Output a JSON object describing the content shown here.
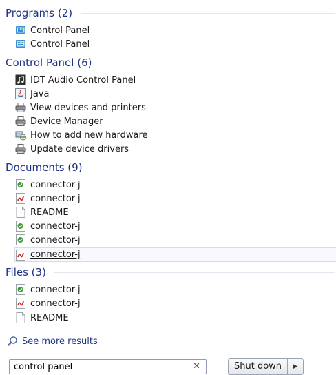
{
  "groups": {
    "programs": {
      "title": "Programs (2)",
      "items": [
        {
          "label": "Control Panel",
          "icon": "control-panel-icon"
        },
        {
          "label": "Control Panel",
          "icon": "control-panel-icon"
        }
      ]
    },
    "control_panel": {
      "title": "Control Panel (6)",
      "items": [
        {
          "label": "IDT Audio Control Panel",
          "icon": "audio-note-icon"
        },
        {
          "label": "Java",
          "icon": "java-icon"
        },
        {
          "label": "View devices and printers",
          "icon": "printer-icon"
        },
        {
          "label": "Device Manager",
          "icon": "printer-icon"
        },
        {
          "label": "How to add new hardware",
          "icon": "hardware-icon"
        },
        {
          "label": "Update device drivers",
          "icon": "printer-icon"
        }
      ]
    },
    "documents": {
      "title": "Documents (9)",
      "items": [
        {
          "label": "connector-j",
          "icon": "green-doc-icon"
        },
        {
          "label": "connector-j",
          "icon": "red-doc-icon"
        },
        {
          "label": "README",
          "icon": "text-file-icon"
        },
        {
          "label": "connector-j",
          "icon": "green-doc-icon"
        },
        {
          "label": "connector-j",
          "icon": "green-doc-icon"
        },
        {
          "label": "connector-j",
          "icon": "red-doc-icon",
          "selected": true
        }
      ]
    },
    "files": {
      "title": "Files (3)",
      "items": [
        {
          "label": "connector-j",
          "icon": "green-doc-icon"
        },
        {
          "label": "connector-j",
          "icon": "red-doc-icon"
        },
        {
          "label": "README",
          "icon": "text-file-icon"
        }
      ]
    }
  },
  "see_more": {
    "label": "See more results",
    "icon": "magnifier-icon"
  },
  "search": {
    "value": "control panel",
    "clear_icon": "close-icon"
  },
  "shutdown": {
    "label": "Shut down",
    "arrow_icon": "triangle-right-icon"
  },
  "colors": {
    "group_title": "#1e3287",
    "link": "#1e3287"
  }
}
